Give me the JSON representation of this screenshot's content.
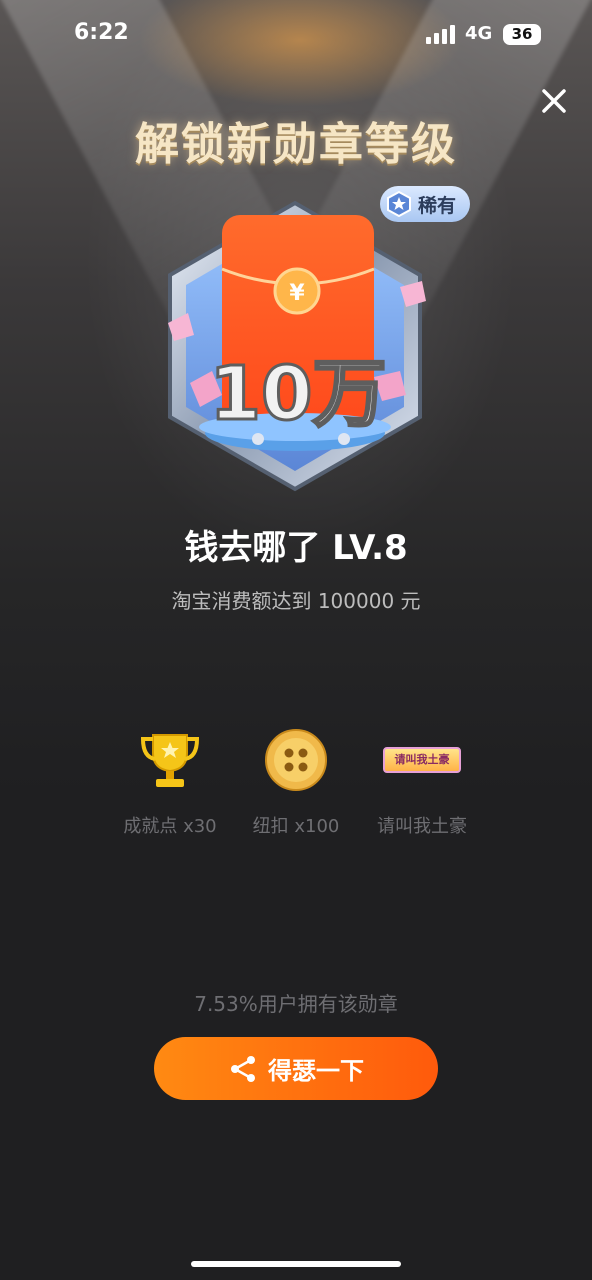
{
  "status_bar": {
    "time": "6:22",
    "network": "4G",
    "battery": "36"
  },
  "modal": {
    "title": "解锁新勋章等级",
    "rarity_label": "稀有",
    "badge_text": "10万",
    "badge_name": "钱去哪了 LV.8",
    "description": "淘宝消费额达到 100000 元",
    "rewards": [
      {
        "icon": "trophy-icon",
        "label": "成就点 x30"
      },
      {
        "icon": "button-coin-icon",
        "label": "纽扣 x100"
      },
      {
        "icon": "title-tag-icon",
        "label": "请叫我土豪",
        "tag_text": "请叫我土豪"
      }
    ],
    "ownership": "7.53%用户拥有该勋章",
    "share_label": "得瑟一下"
  },
  "colors": {
    "accent": "#ff6a10",
    "title_gold": "#f6e6c5",
    "muted": "#6e6e72"
  }
}
